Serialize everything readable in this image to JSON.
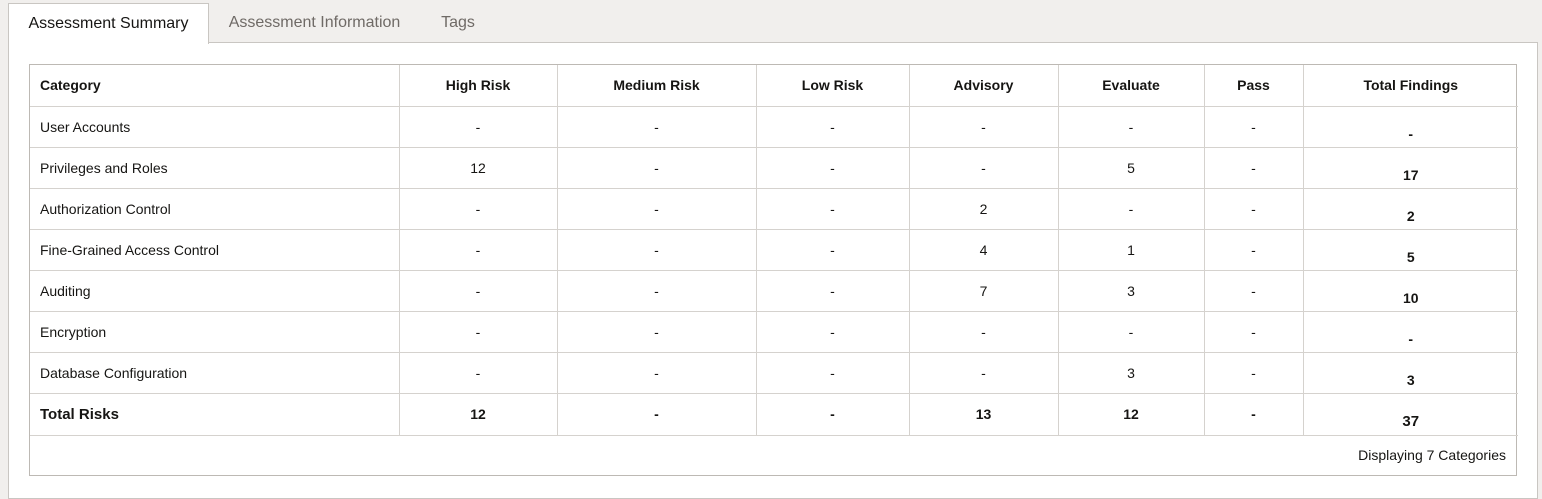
{
  "tabs": [
    {
      "label": "Assessment Summary",
      "active": true
    },
    {
      "label": "Assessment Information",
      "active": false
    },
    {
      "label": "Tags",
      "active": false
    }
  ],
  "table": {
    "columns": [
      "Category",
      "High Risk",
      "Medium Risk",
      "Low Risk",
      "Advisory",
      "Evaluate",
      "Pass",
      "Total Findings"
    ],
    "rows": [
      [
        "User Accounts",
        "-",
        "-",
        "-",
        "-",
        "-",
        "-",
        "-"
      ],
      [
        "Privileges and Roles",
        "12",
        "-",
        "-",
        "-",
        "5",
        "-",
        "17"
      ],
      [
        "Authorization Control",
        "-",
        "-",
        "-",
        "2",
        "-",
        "-",
        "2"
      ],
      [
        "Fine-Grained Access Control",
        "-",
        "-",
        "-",
        "4",
        "1",
        "-",
        "5"
      ],
      [
        "Auditing",
        "-",
        "-",
        "-",
        "7",
        "3",
        "-",
        "10"
      ],
      [
        "Encryption",
        "-",
        "-",
        "-",
        "-",
        "-",
        "-",
        "-"
      ],
      [
        "Database Configuration",
        "-",
        "-",
        "-",
        "-",
        "3",
        "-",
        "3"
      ]
    ],
    "total_row": [
      "Total Risks",
      "12",
      "-",
      "-",
      "13",
      "12",
      "-",
      "37"
    ]
  },
  "footer": {
    "status": "Displaying 7 Categories"
  }
}
